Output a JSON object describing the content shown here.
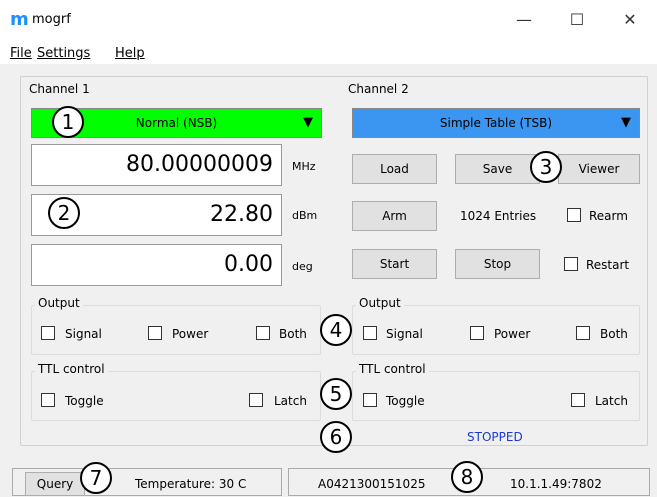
{
  "window": {
    "title": "mogrf",
    "logo": "m"
  },
  "window_controls": {
    "minimize": "—",
    "maximize": "☐",
    "close": "✕"
  },
  "menu": {
    "file": "File",
    "settings": "Settings",
    "help": "Help"
  },
  "channel1": {
    "label": "Channel 1",
    "mode": "Normal (NSB)",
    "frequency": "80.00000009",
    "frequency_unit": "MHz",
    "power": "22.80",
    "power_unit": "dBm",
    "phase": "0.00",
    "phase_unit": "deg",
    "output": {
      "label": "Output",
      "signal": "Signal",
      "power": "Power",
      "both": "Both"
    },
    "ttl": {
      "label": "TTL control",
      "toggle": "Toggle",
      "latch": "Latch"
    }
  },
  "channel2": {
    "label": "Channel 2",
    "mode": "Simple Table (TSB)",
    "load": "Load",
    "save": "Save",
    "viewer": "Viewer",
    "arm": "Arm",
    "entries": "1024 Entries",
    "rearm": "Rearm",
    "start": "Start",
    "stop": "Stop",
    "restart": "Restart",
    "output": {
      "label": "Output",
      "signal": "Signal",
      "power": "Power",
      "both": "Both"
    },
    "ttl": {
      "label": "TTL control",
      "toggle": "Toggle",
      "latch": "Latch"
    },
    "status": "STOPPED"
  },
  "statusbar": {
    "query": "Query",
    "temperature": "Temperature: 30 C",
    "serial": "A0421300151025",
    "address": "10.1.1.49:7802"
  },
  "callouts": [
    "1",
    "2",
    "3",
    "4",
    "5",
    "6",
    "7",
    "8"
  ],
  "colors": {
    "ch1_dropdown": "#00ff00",
    "ch2_dropdown": "#3a96f0",
    "status_text": "#1a3ad6",
    "logo": "#1e90ff"
  }
}
